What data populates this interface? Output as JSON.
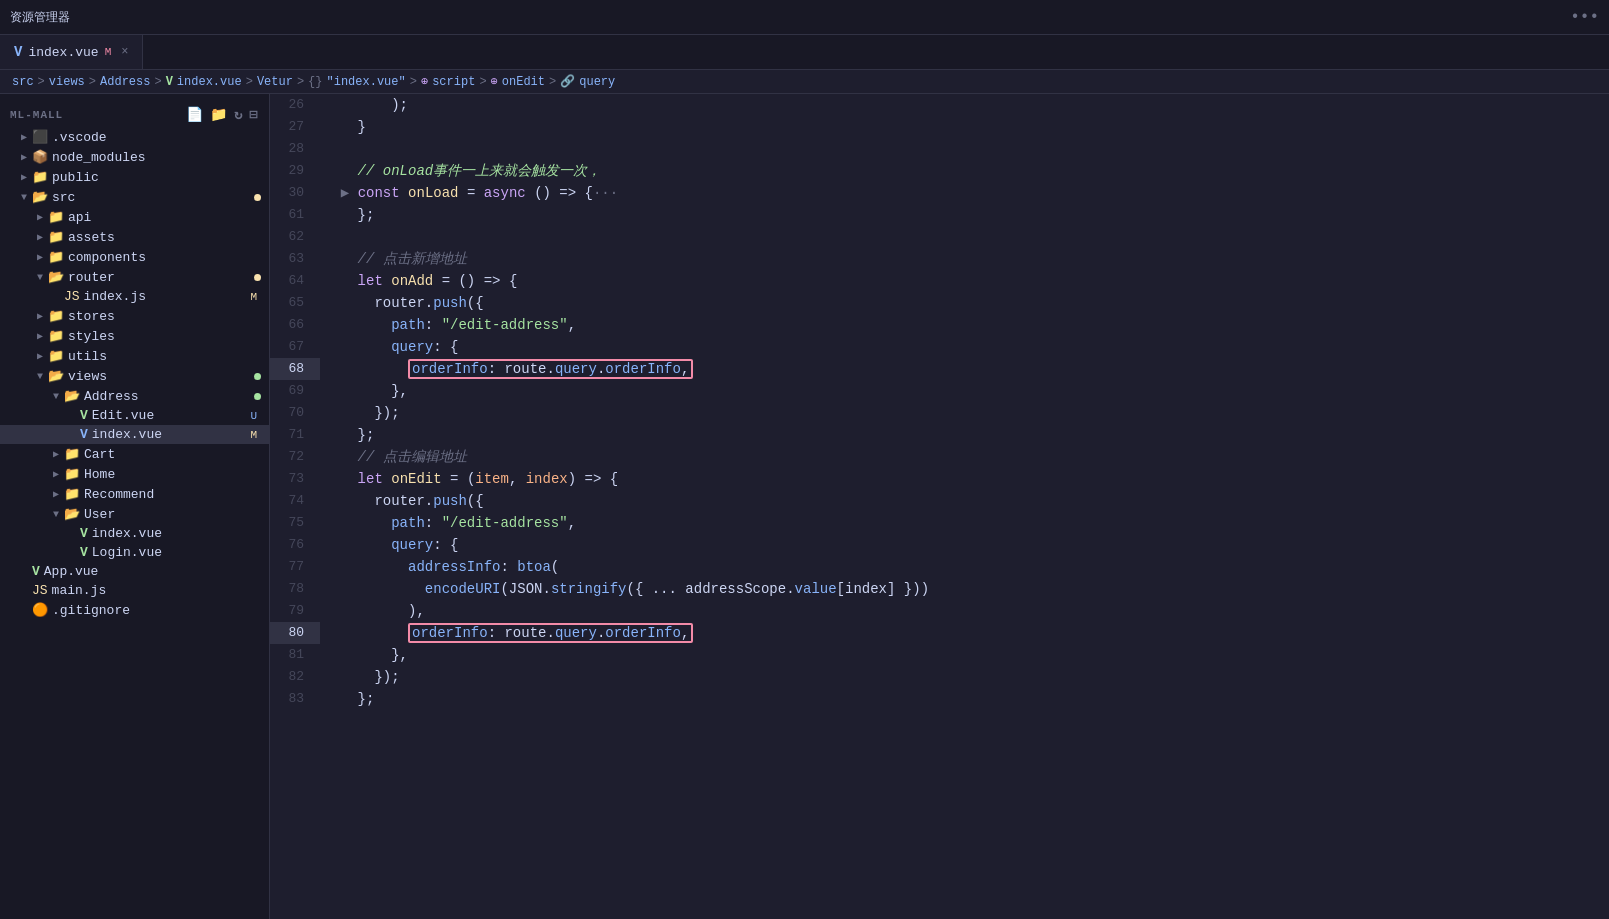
{
  "titlebar": {
    "label": "资源管理器",
    "dots": "•••"
  },
  "tab": {
    "icon": "V",
    "filename": "index.vue",
    "modified_badge": "M",
    "close": "×"
  },
  "breadcrumb": {
    "parts": [
      "src",
      ">",
      "views",
      ">",
      "Address",
      ">",
      "V",
      "index.vue",
      ">",
      "Vetur",
      ">",
      "{}",
      "\"index.vue\"",
      ">",
      "⊕",
      "script",
      ">",
      "⊕",
      "onEdit",
      ">",
      "🔗",
      "query"
    ]
  },
  "sidebar": {
    "title": "资源管理器",
    "project": "ML-MALL",
    "items": [
      {
        "id": "vscode",
        "label": ".vscode",
        "indent": 1,
        "type": "folder",
        "expanded": false
      },
      {
        "id": "node_modules",
        "label": "node_modules",
        "indent": 1,
        "type": "folder-node",
        "expanded": false
      },
      {
        "id": "public",
        "label": "public",
        "indent": 1,
        "type": "folder",
        "expanded": false
      },
      {
        "id": "src",
        "label": "src",
        "indent": 1,
        "type": "folder",
        "expanded": true,
        "dot": "yellow"
      },
      {
        "id": "api",
        "label": "api",
        "indent": 2,
        "type": "folder",
        "expanded": false
      },
      {
        "id": "assets",
        "label": "assets",
        "indent": 2,
        "type": "folder",
        "expanded": false
      },
      {
        "id": "components",
        "label": "components",
        "indent": 2,
        "type": "folder",
        "expanded": false
      },
      {
        "id": "router",
        "label": "router",
        "indent": 2,
        "type": "folder",
        "expanded": true,
        "dot": "yellow"
      },
      {
        "id": "router-index",
        "label": "index.js",
        "indent": 3,
        "type": "js",
        "badge": "M"
      },
      {
        "id": "stores",
        "label": "stores",
        "indent": 2,
        "type": "folder",
        "expanded": false
      },
      {
        "id": "styles",
        "label": "styles",
        "indent": 2,
        "type": "folder",
        "expanded": false
      },
      {
        "id": "utils",
        "label": "utils",
        "indent": 2,
        "type": "folder",
        "expanded": false
      },
      {
        "id": "views",
        "label": "views",
        "indent": 2,
        "type": "folder",
        "expanded": true,
        "dot": "green"
      },
      {
        "id": "address",
        "label": "Address",
        "indent": 3,
        "type": "folder",
        "expanded": true,
        "dot": "green"
      },
      {
        "id": "edit-vue",
        "label": "Edit.vue",
        "indent": 4,
        "type": "vue",
        "badge": "U"
      },
      {
        "id": "index-vue",
        "label": "index.vue",
        "indent": 4,
        "type": "vue-active",
        "badge": "M",
        "active": true
      },
      {
        "id": "cart",
        "label": "Cart",
        "indent": 3,
        "type": "folder",
        "expanded": false
      },
      {
        "id": "home",
        "label": "Home",
        "indent": 3,
        "type": "folder",
        "expanded": false
      },
      {
        "id": "recommend",
        "label": "Recommend",
        "indent": 3,
        "type": "folder",
        "expanded": false
      },
      {
        "id": "user",
        "label": "User",
        "indent": 3,
        "type": "folder",
        "expanded": true
      },
      {
        "id": "user-index",
        "label": "index.vue",
        "indent": 4,
        "type": "vue"
      },
      {
        "id": "user-login",
        "label": "Login.vue",
        "indent": 4,
        "type": "vue"
      },
      {
        "id": "app-vue",
        "label": "App.vue",
        "indent": 1,
        "type": "vue"
      },
      {
        "id": "main-js",
        "label": "main.js",
        "indent": 1,
        "type": "js"
      },
      {
        "id": "gitignore",
        "label": ".gitignore",
        "indent": 1,
        "type": "git"
      }
    ]
  },
  "code": {
    "lines": [
      {
        "num": 26,
        "content": "        );"
      },
      {
        "num": 27,
        "content": "    }"
      },
      {
        "num": 28,
        "content": ""
      },
      {
        "num": 29,
        "content": "    // onLoad事件一上来就会触发一次，",
        "type": "comment-green"
      },
      {
        "num": 30,
        "content": "  > const onLoad = async () => {···",
        "type": "collapsed"
      },
      {
        "num": 61,
        "content": "    };"
      },
      {
        "num": 62,
        "content": ""
      },
      {
        "num": 63,
        "content": "    // 点击新增地址",
        "type": "comment"
      },
      {
        "num": 64,
        "content": "    let onAdd = () => {"
      },
      {
        "num": 65,
        "content": "      router.push({"
      },
      {
        "num": 66,
        "content": "        path: \"/edit-address\","
      },
      {
        "num": 67,
        "content": "        query: {"
      },
      {
        "num": 68,
        "content": "          orderInfo: route.query.orderInfo,",
        "type": "highlighted"
      },
      {
        "num": 69,
        "content": "        },"
      },
      {
        "num": 70,
        "content": "      });"
      },
      {
        "num": 71,
        "content": "    };"
      },
      {
        "num": 72,
        "content": "    // 点击编辑地址",
        "type": "comment"
      },
      {
        "num": 73,
        "content": "    let onEdit = (item, index) => {"
      },
      {
        "num": 74,
        "content": "      router.push({"
      },
      {
        "num": 75,
        "content": "        path: \"/edit-address\","
      },
      {
        "num": 76,
        "content": "        query: {"
      },
      {
        "num": 77,
        "content": "          addressInfo: btoa("
      },
      {
        "num": 78,
        "content": "            encodeURI(JSON.stringify({ ... addressScope.value[index] }))"
      },
      {
        "num": 79,
        "content": "          ),"
      },
      {
        "num": 80,
        "content": "          orderInfo: route.query.orderInfo,",
        "type": "highlighted"
      },
      {
        "num": 81,
        "content": "        },"
      },
      {
        "num": 82,
        "content": "      });"
      },
      {
        "num": 83,
        "content": "    };"
      }
    ]
  }
}
